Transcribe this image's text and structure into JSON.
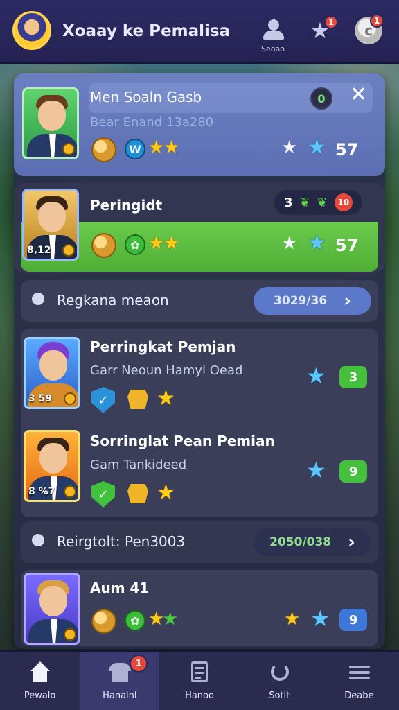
{
  "header": {
    "title": "Xoaay ke Pemalisa",
    "profile_label": "Seoao",
    "notification_badge": "1",
    "coin_badge": "1",
    "coin_symbol": "c"
  },
  "featured": {
    "name": "Men Soaln Gasb",
    "subtitle": "Bear Enand 13a280",
    "status_badge": "0",
    "score": "57"
  },
  "second": {
    "name": "Peringidt",
    "level": "8,12",
    "pill_number": "3",
    "pill_red": "10",
    "score": "57"
  },
  "banner_1": {
    "label": "Regkana meaon",
    "button_value": "3029/36",
    "button_arrow": "›"
  },
  "players": [
    {
      "name": "Perringkat Pemjan",
      "subtitle": "Garr Neoun Hamyl Oead",
      "level": "3 59",
      "badge": "3"
    },
    {
      "name": "Sorringlat Pean Pemian",
      "subtitle": "Gam Tankideed",
      "level": "8 %7",
      "badge": "9"
    }
  ],
  "banner_2": {
    "label": "Reirgtolt: Pen3003",
    "button_value": "2050/038",
    "button_arrow": "›"
  },
  "last": {
    "name": "Aum 41",
    "badge": "9"
  },
  "nav": {
    "items": [
      "Pewalo",
      "Hanainl",
      "Hanoo",
      "Sotlt",
      "Deabe"
    ],
    "shop_badge": "1"
  },
  "colors": {
    "topbar": "#2c2a63",
    "green_accent": "#4fae35",
    "blue_button": "#5c79c9",
    "badge_red": "#e8483a"
  }
}
